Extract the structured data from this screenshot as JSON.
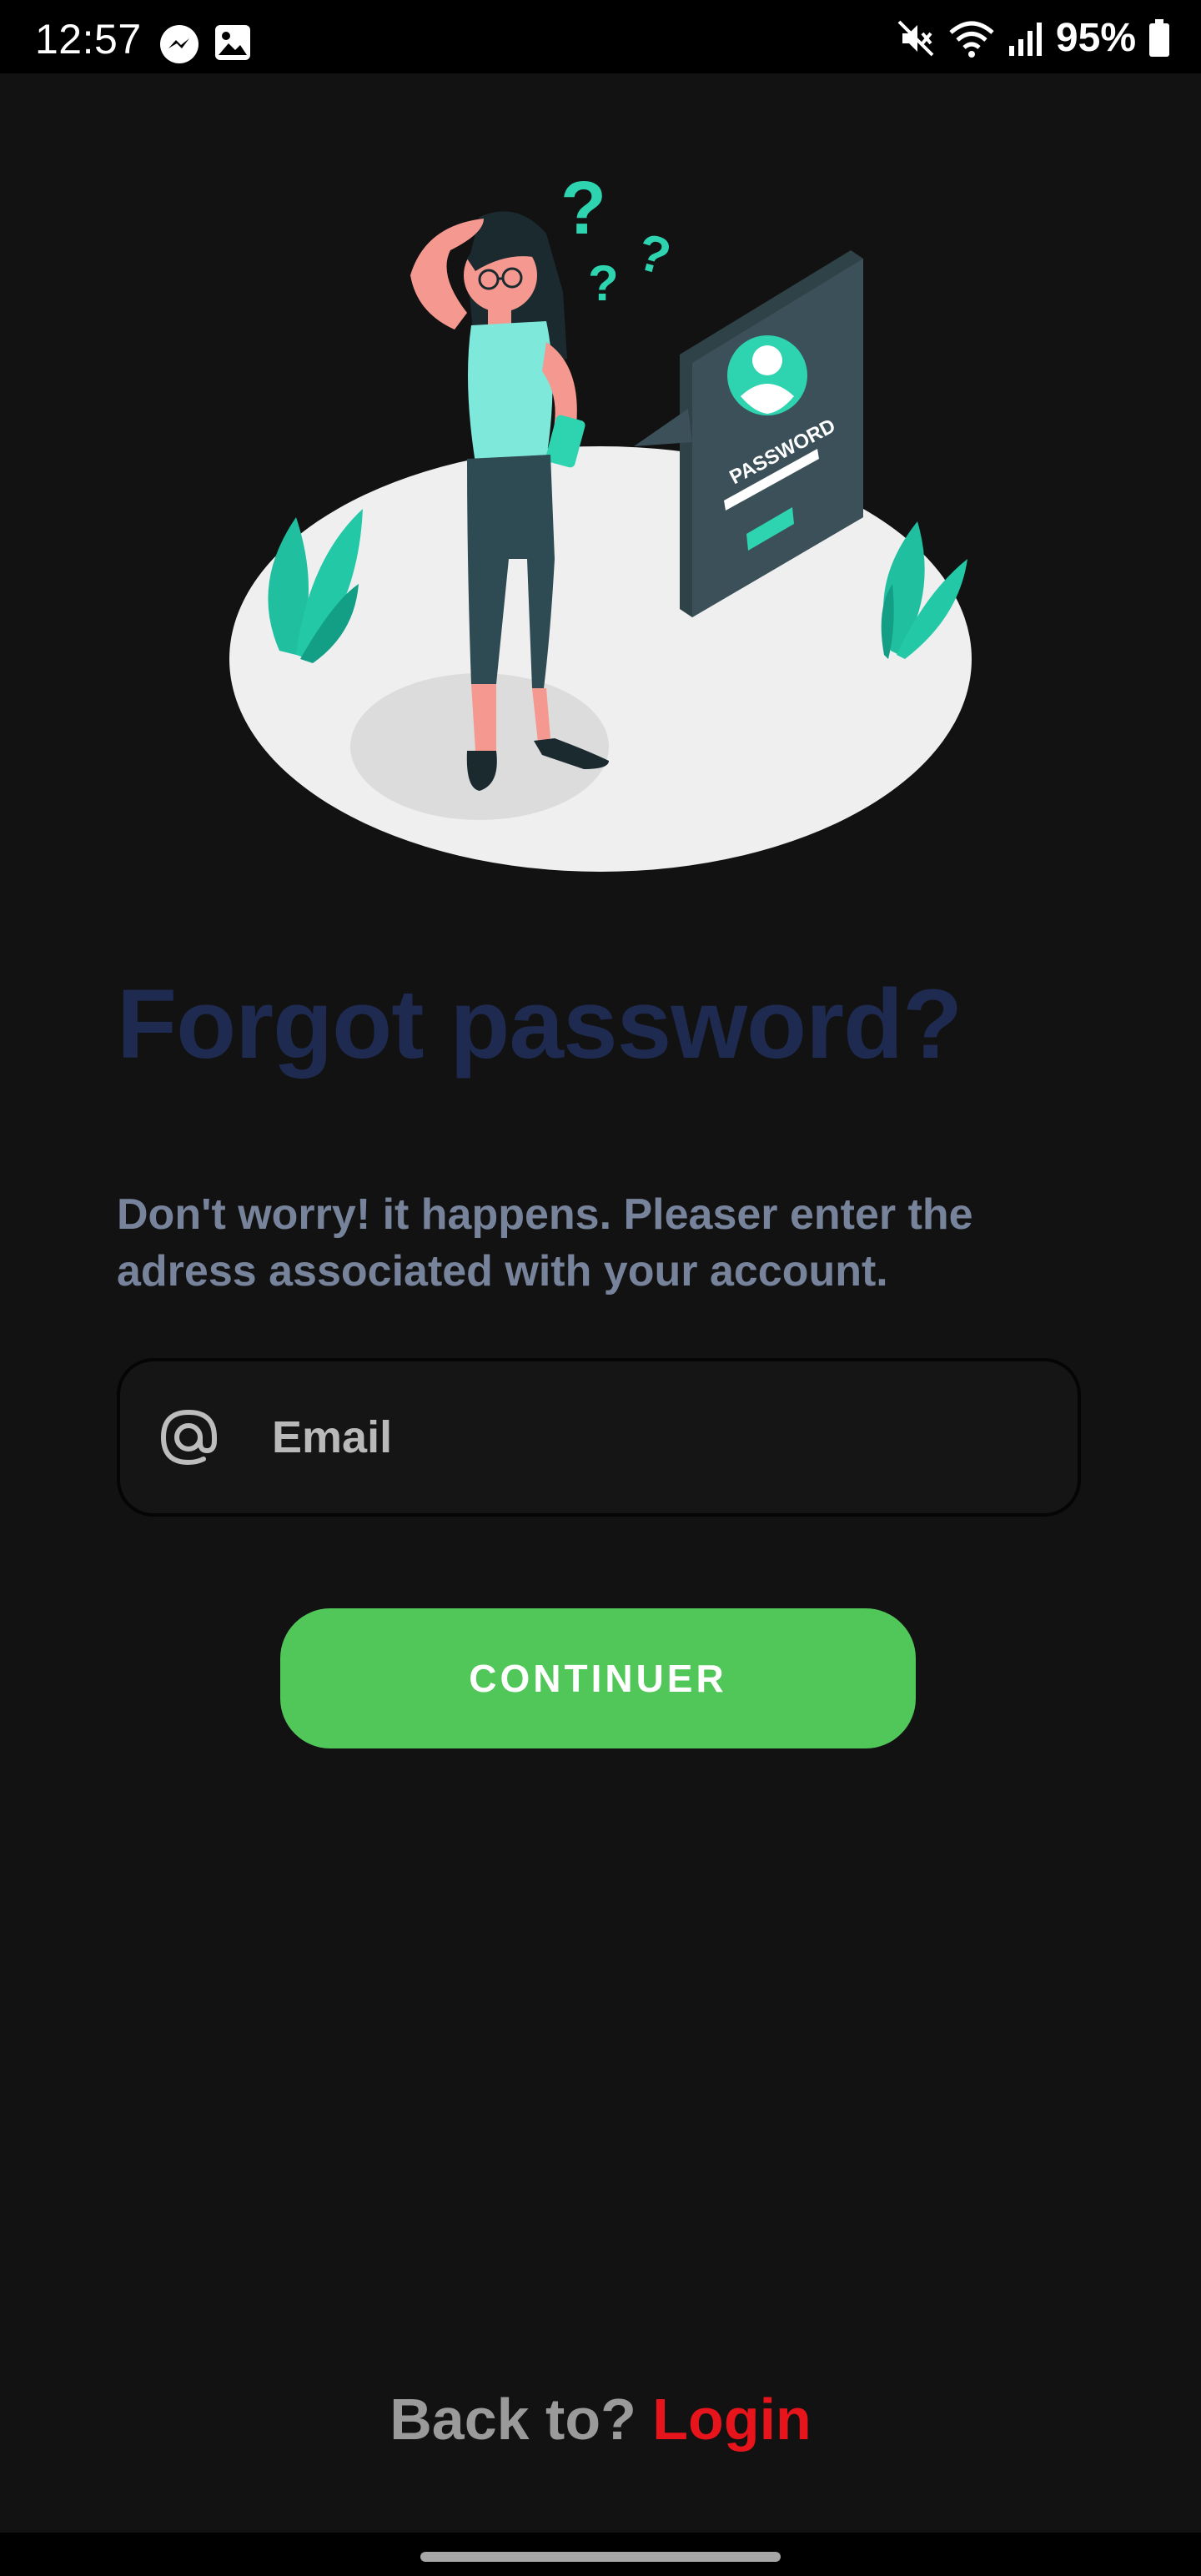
{
  "status_bar": {
    "time": "12:57",
    "left_icons": [
      "messenger-icon",
      "gallery-icon"
    ],
    "right_icons": [
      "mute-icon",
      "wifi-icon",
      "signal-icon",
      "battery-icon"
    ],
    "battery_text": "95%"
  },
  "hero": {
    "illustration": "forgot-password-illustration",
    "card_label": "PASSWORD"
  },
  "title": "Forgot password?",
  "subtitle": "Don't worry! it happens. Pleaser enter the adress associated with your account.",
  "email_field": {
    "icon": "at-sign-icon",
    "value": "",
    "placeholder": "Email"
  },
  "continue_button": {
    "label": "CONTINUER"
  },
  "footer": {
    "prefix": "Back to? ",
    "link": "Login"
  },
  "colors": {
    "background": "#121212",
    "title": "#1e2a4f",
    "subtitle": "#76839a",
    "button": "#51c75a",
    "link": "#e8141b",
    "accent": "#2ed3b0"
  }
}
